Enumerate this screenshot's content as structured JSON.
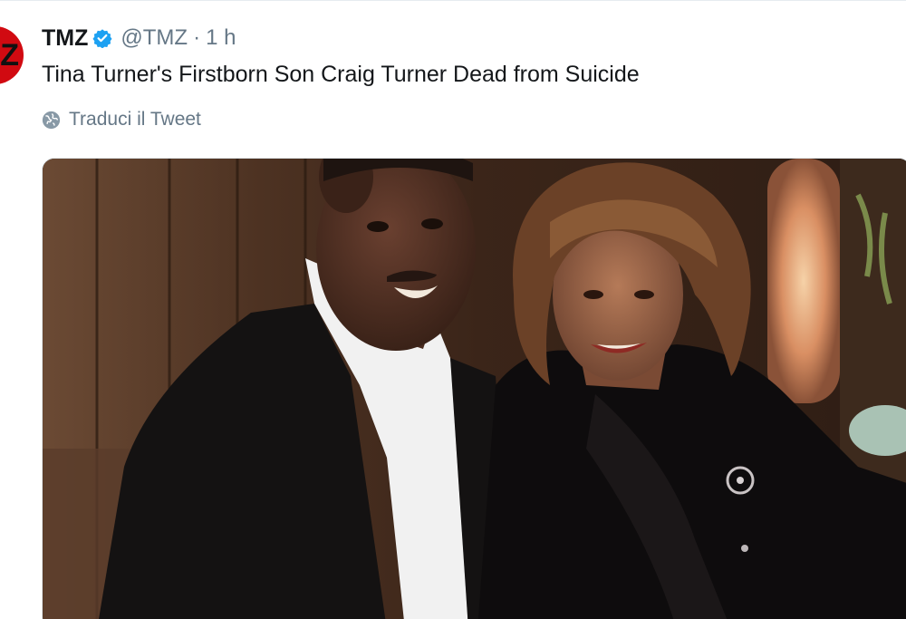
{
  "tweet": {
    "author_name": "TMZ",
    "handle": "@TMZ",
    "separator": "·",
    "timestamp": "1 h",
    "text": "Tina Turner's Firstborn Son Craig Turner Dead from Suicide",
    "translate_label": "Traduci il Tweet",
    "avatar_letter": "Z"
  },
  "icons": {
    "verified": "verified-badge-icon",
    "translate": "globe-icon"
  },
  "colors": {
    "verified_blue": "#1da1f2",
    "secondary_text": "#657786",
    "avatar_red": "#d10a11"
  }
}
